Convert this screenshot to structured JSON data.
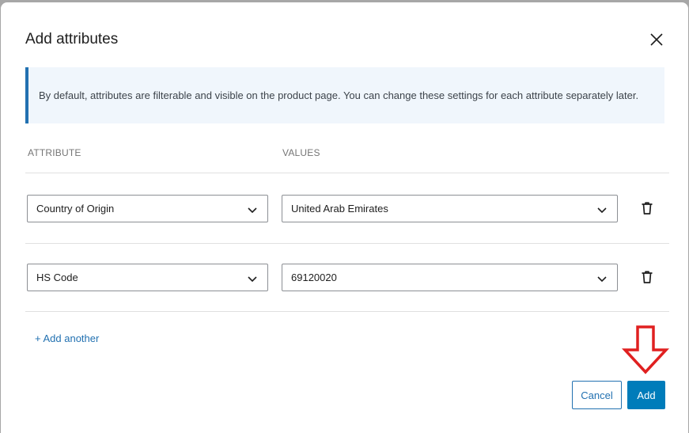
{
  "dialog": {
    "title": "Add attributes",
    "notice": "By default, attributes are filterable and visible on the product page. You can change these settings for each attribute separately later."
  },
  "columns": {
    "attribute": "ATTRIBUTE",
    "values": "VALUES"
  },
  "rows": [
    {
      "attribute": "Country of Origin",
      "value": "United Arab Emirates"
    },
    {
      "attribute": "HS Code",
      "value": "69120020"
    }
  ],
  "add_another_label": "+ Add another",
  "buttons": {
    "cancel": "Cancel",
    "add": "Add"
  },
  "colors": {
    "accent": "#007cba",
    "notice_border": "#2271b1",
    "arrow": "#e02020"
  },
  "icons": {
    "close": "close-icon",
    "chevron": "chevron-down-icon",
    "delete": "trash-icon",
    "pointer": "down-arrow-icon"
  }
}
